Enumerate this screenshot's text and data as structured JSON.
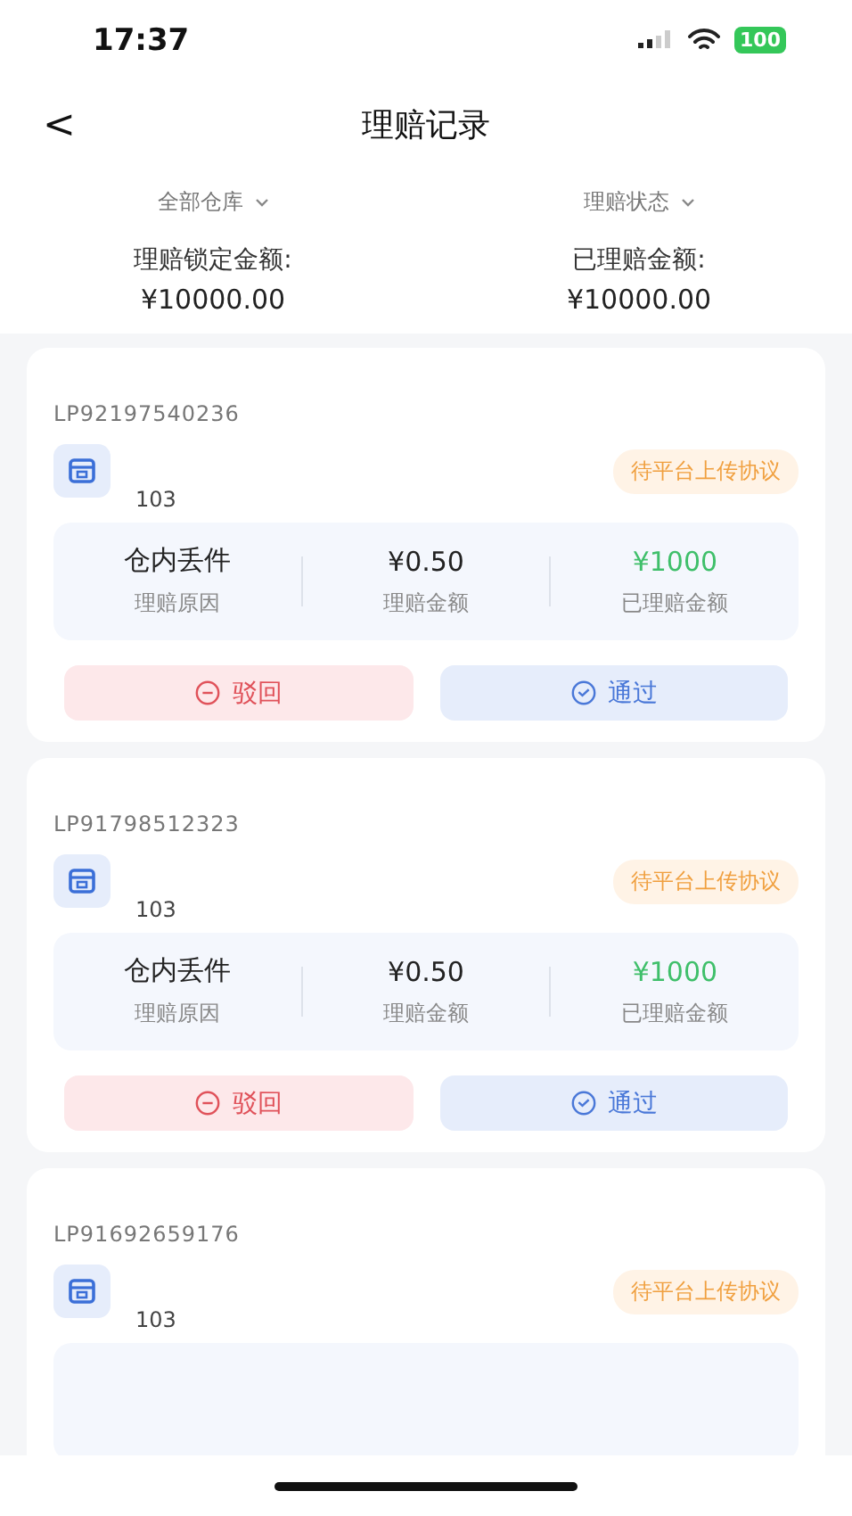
{
  "status_bar": {
    "time": "17:37",
    "battery": "100"
  },
  "nav": {
    "back": "<",
    "title": "理赔记录"
  },
  "filters": [
    {
      "label": "全部仓库"
    },
    {
      "label": "理赔状态"
    }
  ],
  "summary": [
    {
      "label": "理赔锁定金额:",
      "value": "¥10000.00"
    },
    {
      "label": "已理赔金额:",
      "value": "¥10000.00"
    }
  ],
  "claims": [
    {
      "id": "LP92197540236",
      "store": "103",
      "status": "待平台上传协议",
      "stats": [
        {
          "value": "仓内丢件",
          "label": "理赔原因",
          "kind": "text"
        },
        {
          "value": "¥0.50",
          "label": "理赔金额",
          "kind": "amount"
        },
        {
          "value": "¥1000",
          "label": "已理赔金额",
          "kind": "paid"
        }
      ],
      "actions": [
        {
          "label": "驳回",
          "kind": "reject"
        },
        {
          "label": "通过",
          "kind": "approve"
        }
      ]
    },
    {
      "id": "LP91798512323",
      "store": "103",
      "status": "待平台上传协议",
      "stats": [
        {
          "value": "仓内丢件",
          "label": "理赔原因",
          "kind": "text"
        },
        {
          "value": "¥0.50",
          "label": "理赔金额",
          "kind": "amount"
        },
        {
          "value": "¥1000",
          "label": "已理赔金额",
          "kind": "paid"
        }
      ],
      "actions": [
        {
          "label": "驳回",
          "kind": "reject"
        },
        {
          "label": "通过",
          "kind": "approve"
        }
      ]
    },
    {
      "id": "LP91692659176",
      "store": "103",
      "status": "待平台上传协议"
    }
  ]
}
